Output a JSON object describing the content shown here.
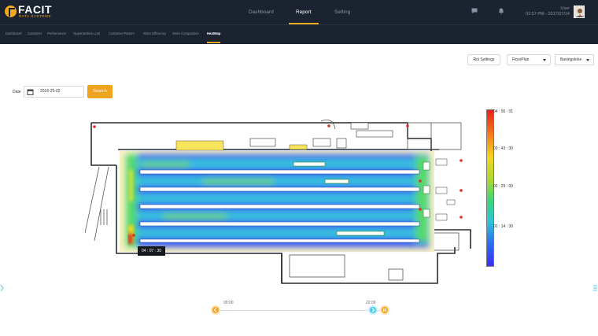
{
  "brand": {
    "name": "FACIT",
    "tagline": "DATA SYSTEMS"
  },
  "nav": [
    {
      "label": "Dashboard",
      "active": false
    },
    {
      "label": "Report",
      "active": true
    },
    {
      "label": "Setting",
      "active": false
    }
  ],
  "header_icons": [
    "chat-icon",
    "bell-icon"
  ],
  "user": {
    "name": "User",
    "datetime": "02:57 PM - 2017/07/14"
  },
  "subnav": [
    {
      "label": "Dashboard",
      "active": false
    },
    {
      "label": "Customer",
      "active": false
    },
    {
      "label": "Performance",
      "active": false
    },
    {
      "label": "Opportunities Lost",
      "active": false
    },
    {
      "label": "Customer Pattern",
      "active": false
    },
    {
      "label": "Store Efficiency",
      "active": false
    },
    {
      "label": "Store Comparison",
      "active": false
    },
    {
      "label": "HeatMap",
      "active": true
    }
  ],
  "toolbar": {
    "roi_label": "Roi Settings",
    "floorplan_label": "FloorPlan",
    "store_label": "Basingstoke"
  },
  "filter": {
    "date_label": "Date",
    "date_value": "2016-25-02",
    "search_label": "Search"
  },
  "heatmap": {
    "tooltip": "04 : 07 : 30"
  },
  "legend": {
    "labels": [
      "04 : 56 : 01",
      "03 : 43 : 30",
      "02 : 29 : 00",
      "01 : 14 : 30"
    ],
    "colors": [
      "#e8211a",
      "#f3731c",
      "#f7d51d",
      "#a9d736",
      "#3ed57a",
      "#2ec3d8",
      "#2a6bf2",
      "#3a2ff0"
    ]
  },
  "timeline": {
    "start": "09:00",
    "end": "22:00"
  },
  "colors": {
    "accent": "#f0a31e",
    "header_bg": "#1b2230",
    "timeline_end": "#4fc9e8"
  }
}
